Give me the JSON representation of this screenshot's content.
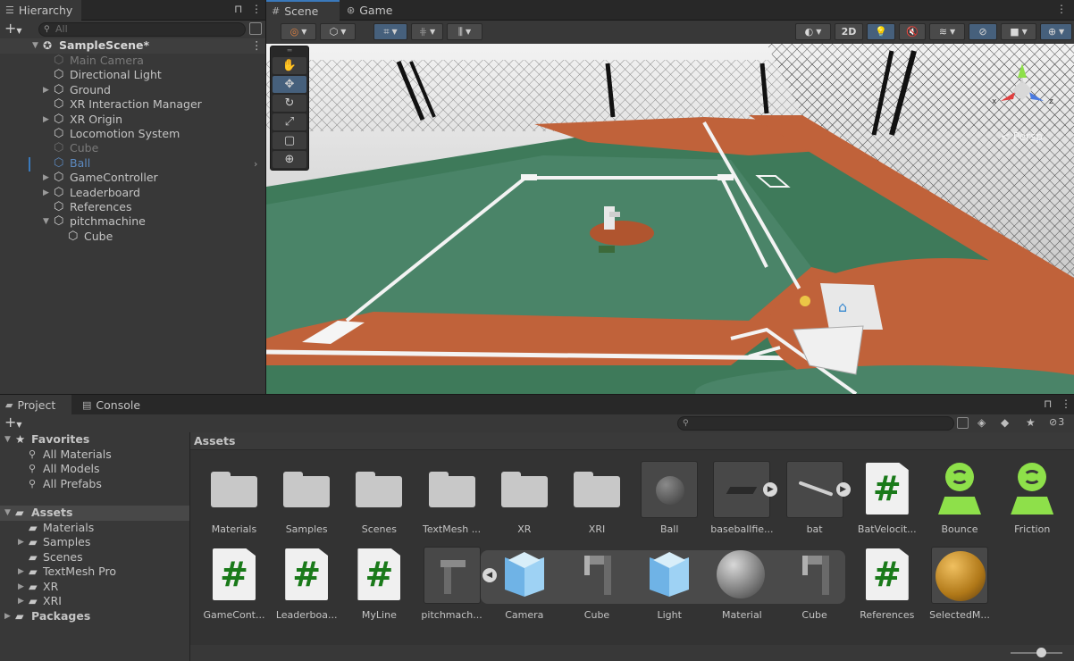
{
  "hierarchy": {
    "tab_label": "Hierarchy",
    "search_placeholder": "All",
    "add_label": "+",
    "scene_name": "SampleScene*",
    "items": [
      {
        "label": "Main Camera",
        "indent": 1,
        "state": "dim",
        "expand": false
      },
      {
        "label": "Directional Light",
        "indent": 1,
        "state": "normal",
        "expand": false
      },
      {
        "label": "Ground",
        "indent": 1,
        "state": "normal",
        "expand": true
      },
      {
        "label": "XR Interaction Manager",
        "indent": 1,
        "state": "normal",
        "expand": false
      },
      {
        "label": "XR Origin",
        "indent": 1,
        "state": "normal",
        "expand": true
      },
      {
        "label": "Locomotion System",
        "indent": 1,
        "state": "normal",
        "expand": false
      },
      {
        "label": "Cube",
        "indent": 1,
        "state": "dim",
        "expand": false
      },
      {
        "label": "Ball",
        "indent": 1,
        "state": "selected",
        "expand": false
      },
      {
        "label": "GameController",
        "indent": 1,
        "state": "normal",
        "expand": true
      },
      {
        "label": "Leaderboard",
        "indent": 1,
        "state": "normal",
        "expand": true
      },
      {
        "label": "References",
        "indent": 1,
        "state": "normal",
        "expand": false
      },
      {
        "label": "pitchmachine",
        "indent": 1,
        "state": "normal",
        "expand": "open"
      },
      {
        "label": "Cube",
        "indent": 2,
        "state": "normal",
        "expand": false
      }
    ]
  },
  "scene_tabs": {
    "scene": "Scene",
    "game": "Game"
  },
  "scene_toolbar": {
    "mode_2d": "2D",
    "view_label": "< Persp"
  },
  "gizmo": {
    "x": "x",
    "z": "z"
  },
  "bottom_tabs": {
    "project": "Project",
    "console": "Console"
  },
  "project": {
    "add_label": "+",
    "badge_count": "3",
    "breadcrumb": "Assets",
    "favorites": {
      "label": "Favorites",
      "items": [
        "All Materials",
        "All Models",
        "All Prefabs"
      ]
    },
    "assets_root": {
      "label": "Assets",
      "children": [
        {
          "label": "Materials",
          "expand": false
        },
        {
          "label": "Samples",
          "expand": true
        },
        {
          "label": "Scenes",
          "expand": false
        },
        {
          "label": "TextMesh Pro",
          "expand": true
        },
        {
          "label": "XR",
          "expand": true
        },
        {
          "label": "XRI",
          "expand": true
        }
      ]
    },
    "packages_label": "Packages"
  },
  "assets_row1": [
    {
      "name": "Materials",
      "kind": "folder"
    },
    {
      "name": "Samples",
      "kind": "folder"
    },
    {
      "name": "Scenes",
      "kind": "folder"
    },
    {
      "name": "TextMesh ...",
      "kind": "folder"
    },
    {
      "name": "XR",
      "kind": "folder"
    },
    {
      "name": "XRI",
      "kind": "folder"
    },
    {
      "name": "Ball",
      "kind": "model-sphere"
    },
    {
      "name": "baseballfie...",
      "kind": "model-field"
    },
    {
      "name": "bat",
      "kind": "model-bat"
    },
    {
      "name": "BatVelocit...",
      "kind": "script"
    },
    {
      "name": "Bounce",
      "kind": "physic-material"
    },
    {
      "name": "Friction",
      "kind": "physic-material"
    }
  ],
  "assets_row2": [
    {
      "name": "GameCont...",
      "kind": "script"
    },
    {
      "name": "Leaderboa...",
      "kind": "script"
    },
    {
      "name": "MyLine",
      "kind": "script"
    },
    {
      "name": "pitchmach...",
      "kind": "model-machine"
    },
    {
      "name": "Camera",
      "kind": "mesh-cube"
    },
    {
      "name": "Cube",
      "kind": "mesh-frame"
    },
    {
      "name": "Light",
      "kind": "mesh-cube"
    },
    {
      "name": "Material",
      "kind": "material-sphere"
    },
    {
      "name": "Cube",
      "kind": "mesh-frame"
    },
    {
      "name": "References",
      "kind": "script"
    },
    {
      "name": "SelectedM...",
      "kind": "material-gold"
    }
  ],
  "colors": {
    "accent": "#3a79bb",
    "script_hash": "#1a7a1a",
    "physic": "#8ee04a"
  }
}
